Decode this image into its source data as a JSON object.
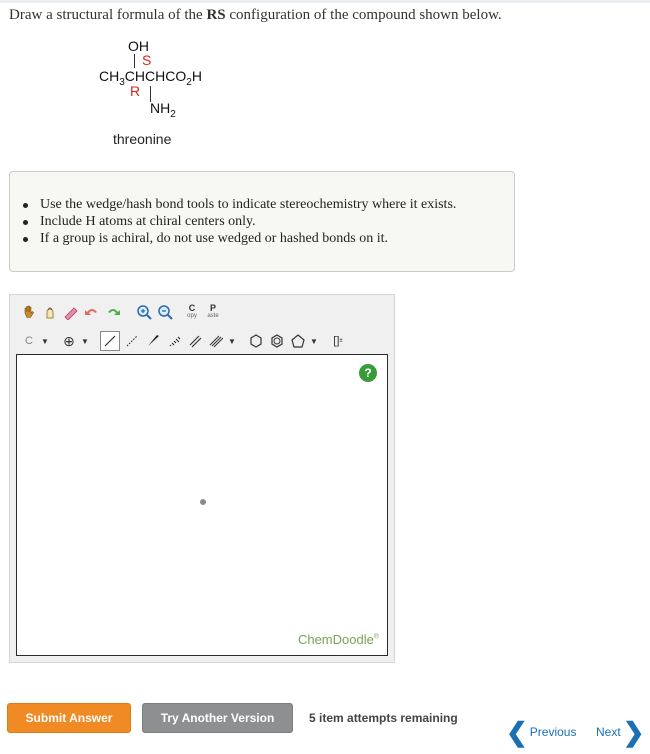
{
  "question": {
    "prefix": "Draw a structural formula of the ",
    "bold": "RS",
    "suffix": " configuration of the compound shown below."
  },
  "molecule": {
    "top_group": "OH",
    "top_label": "S",
    "main_chain": "CH3CHCHCO2H",
    "left_label": "R",
    "bottom_group": "NH2",
    "name": "threonine"
  },
  "hints": [
    "Use the wedge/hash bond tools to indicate stereochemistry where it exists.",
    "Include H atoms at chiral centers only.",
    "If a group is achiral, do not use wedged or hashed bonds on it."
  ],
  "editor": {
    "toolbar_row1": [
      "hand-icon",
      "erase-icon",
      "lasso-icon",
      "undo-icon",
      "redo-icon",
      "zoom-in-icon",
      "zoom-out-icon",
      "copy-icon",
      "paste-icon"
    ],
    "copy_label": "C",
    "copy_sub": "opy",
    "paste_label": "P",
    "paste_sub": "aste",
    "element_selector": "C",
    "charge_label": "⊕",
    "help_label": "?",
    "brand": "ChemDoodle",
    "brand_mark": "®"
  },
  "actions": {
    "submit": "Submit Answer",
    "try_another": "Try Another Version",
    "attempts": "5 item attempts remaining",
    "previous": "Previous",
    "next": "Next"
  },
  "colors": {
    "submit": "#f08a24",
    "try_another": "#8d8f91",
    "stereo_label": "#d9261c",
    "link": "#1a6fb5",
    "help": "#3a9b3a"
  }
}
